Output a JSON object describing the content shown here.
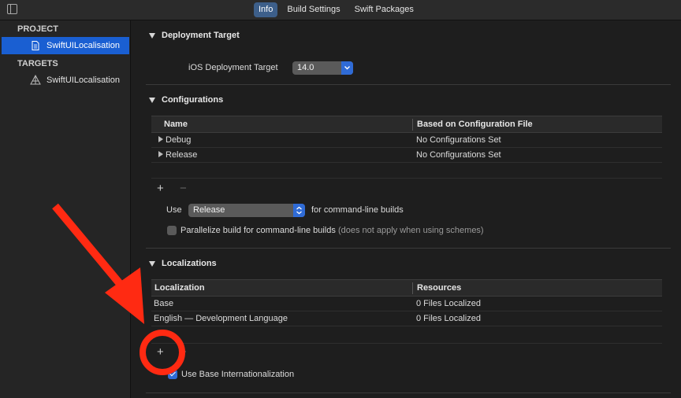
{
  "tabs": [
    {
      "label": "Info",
      "active": true
    },
    {
      "label": "Build Settings",
      "active": false
    },
    {
      "label": "Swift Packages",
      "active": false
    }
  ],
  "sidebar": {
    "project_header": "PROJECT",
    "project_item": "SwiftUILocalisation",
    "targets_header": "TARGETS",
    "target_item": "SwiftUILocalisation"
  },
  "deployment": {
    "title": "Deployment Target",
    "label": "iOS Deployment Target",
    "value": "14.0"
  },
  "configurations": {
    "title": "Configurations",
    "columns": [
      "Name",
      "Based on Configuration File"
    ],
    "rows": [
      {
        "name": "Debug",
        "file": "No Configurations Set"
      },
      {
        "name": "Release",
        "file": "No Configurations Set"
      }
    ],
    "use_label": "Use",
    "use_value": "Release",
    "use_suffix": "for command-line builds",
    "parallelize_label": "Parallelize build for command-line builds",
    "parallelize_note": "(does not apply when using schemes)",
    "parallelize_checked": false
  },
  "localizations": {
    "title": "Localizations",
    "columns": [
      "Localization",
      "Resources"
    ],
    "rows": [
      {
        "name": "Base",
        "resources": "0 Files Localized"
      },
      {
        "name": "English — Development Language",
        "resources": "0 Files Localized"
      }
    ],
    "base_intl_label": "Use Base Internationalization",
    "base_intl_checked": true
  },
  "icons": {
    "plus": "+",
    "minus": "−"
  },
  "colors": {
    "accent": "#1a5fd2",
    "annotation_red": "#ff2a12"
  }
}
